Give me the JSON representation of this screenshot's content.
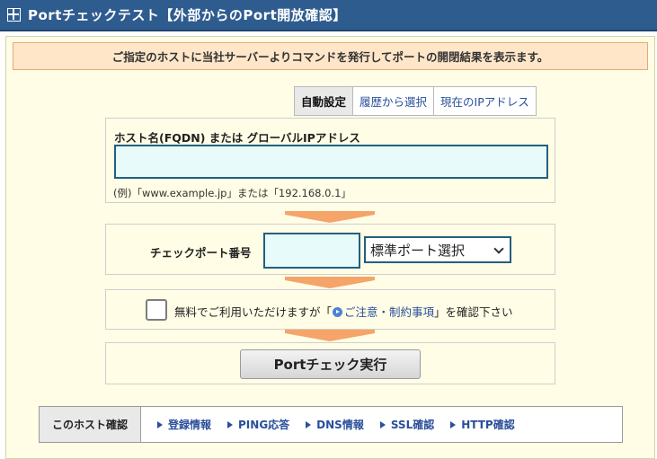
{
  "header": {
    "title": "Portチェックテスト【外部からのPort開放確認】"
  },
  "notice": "ご指定のホストに当社サーバーよりコマンドを発行してポートの開閉結果を表示ます。",
  "tabs": [
    "自動設定",
    "履歴から選択",
    "現在のIPアドレス"
  ],
  "host": {
    "label": "ホスト名(FQDN) または グローバルIPアドレス",
    "value": "",
    "example": "(例)「www.example.jp」または「192.168.0.1」"
  },
  "port": {
    "label": "チェックポート番号",
    "value": "",
    "select_value": "標準ポート選択"
  },
  "agree": {
    "prefix": "無料でご利用いただけますが「",
    "link": "ご注意・制約事項",
    "suffix": "」を確認下さい"
  },
  "exec_button": "Portチェック実行",
  "bottom_nav": {
    "head": "このホスト確認",
    "items": [
      "登録情報",
      "PING応答",
      "DNS情報",
      "SSL確認",
      "HTTP確認"
    ]
  }
}
